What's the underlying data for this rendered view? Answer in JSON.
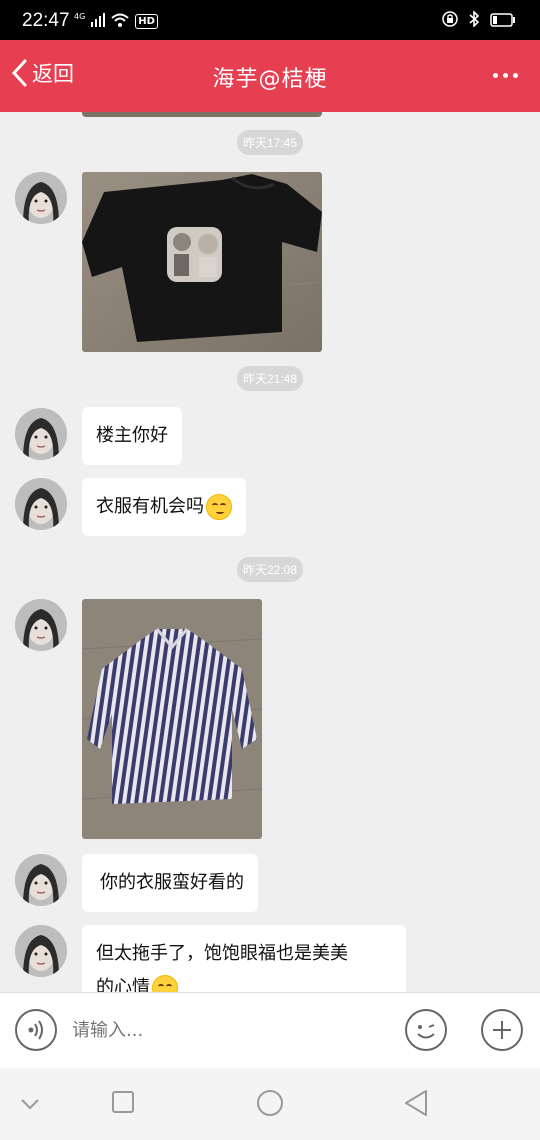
{
  "status_bar": {
    "time": "22:47",
    "network": "4G",
    "icons": [
      "signal-icon",
      "wifi-icon",
      "hd-icon",
      "lock-icon",
      "bluetooth-icon",
      "battery-icon"
    ],
    "hd_label": "HD"
  },
  "header": {
    "back_label": "返回",
    "title": "海芋@桔梗",
    "background": "#e63f52"
  },
  "messages": [
    {
      "type": "timestamp",
      "text": "昨天17:45"
    },
    {
      "type": "image",
      "description_icon": "black-tshirt-photo"
    },
    {
      "type": "timestamp",
      "text": "昨天21:48"
    },
    {
      "type": "text",
      "text": "楼主你好"
    },
    {
      "type": "text",
      "text": "衣服有机会吗",
      "emoji": "smile-emoji"
    },
    {
      "type": "timestamp",
      "text": "昨天22:08"
    },
    {
      "type": "image",
      "description_icon": "striped-shirt-photo"
    },
    {
      "type": "text",
      "text": "你的衣服蛮好看的"
    },
    {
      "type": "text",
      "text_line1": "但太拖手了，饱饱眼福也是美美",
      "text_line2": "的心情",
      "emoji": "smile-emoji"
    }
  ],
  "input": {
    "placeholder": "请输入..."
  },
  "nav": {
    "icons": [
      "chevron-down-icon",
      "recent-apps-icon",
      "home-icon",
      "back-triangle-icon"
    ]
  }
}
